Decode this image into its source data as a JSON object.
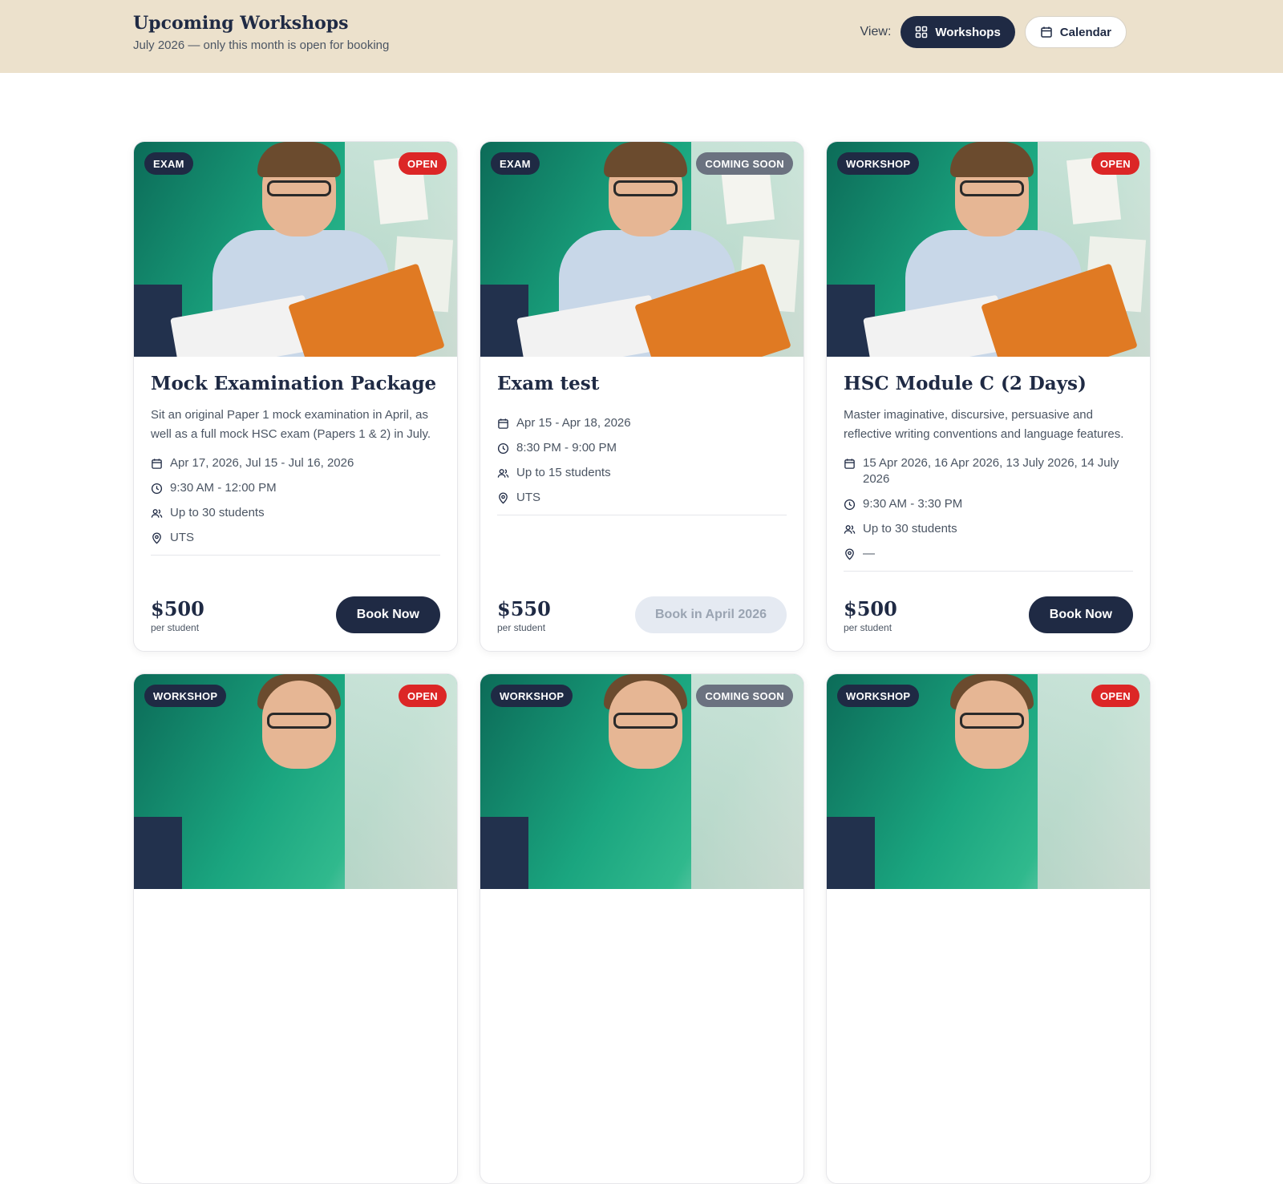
{
  "header": {
    "title": "Upcoming Workshops",
    "subtitle": "July 2026 — only this month is open for booking",
    "view_label": "View:",
    "views": [
      {
        "label": "Workshops",
        "active": true,
        "icon": "grid-icon"
      },
      {
        "label": "Calendar",
        "active": false,
        "icon": "calendar-icon"
      }
    ]
  },
  "colors": {
    "header_bg": "#ece1cc",
    "primary": "#1f2a44",
    "open": "#dc2626",
    "coming_soon": "#6b7280"
  },
  "cards": [
    {
      "type": "EXAM",
      "status": "OPEN",
      "title": "Mock Examination Package",
      "description": "Sit an original Paper 1 mock examination in April, as well as a full mock HSC exam (Papers 1 & 2) in July.",
      "dates": "Apr 17, 2026, Jul 15 - Jul 16, 2026",
      "time": "9:30 AM - 12:00 PM",
      "capacity": "Up to 30 students",
      "location": "UTS",
      "price": "$500",
      "price_unit": "per student",
      "button": "Book Now",
      "button_enabled": true
    },
    {
      "type": "EXAM",
      "status": "COMING SOON",
      "title": "Exam test",
      "description": "",
      "dates": "Apr 15 - Apr 18, 2026",
      "time": "8:30 PM - 9:00 PM",
      "capacity": "Up to 15 students",
      "location": "UTS",
      "price": "$550",
      "price_unit": "per student",
      "button": "Book in April 2026",
      "button_enabled": false
    },
    {
      "type": "WORKSHOP",
      "status": "OPEN",
      "title": "HSC Module C (2 Days)",
      "description": "Master imaginative, discursive, persuasive and reflective writing conventions and language features.",
      "dates": "15 Apr 2026, 16 Apr 2026, 13 July 2026, 14 July 2026",
      "time": "9:30 AM - 3:30 PM",
      "capacity": "Up to 30 students",
      "location": "—",
      "price": "$500",
      "price_unit": "per student",
      "button": "Book Now",
      "button_enabled": true
    },
    {
      "type": "WORKSHOP",
      "status": "OPEN"
    },
    {
      "type": "WORKSHOP",
      "status": "COMING SOON"
    },
    {
      "type": "WORKSHOP",
      "status": "OPEN"
    }
  ]
}
